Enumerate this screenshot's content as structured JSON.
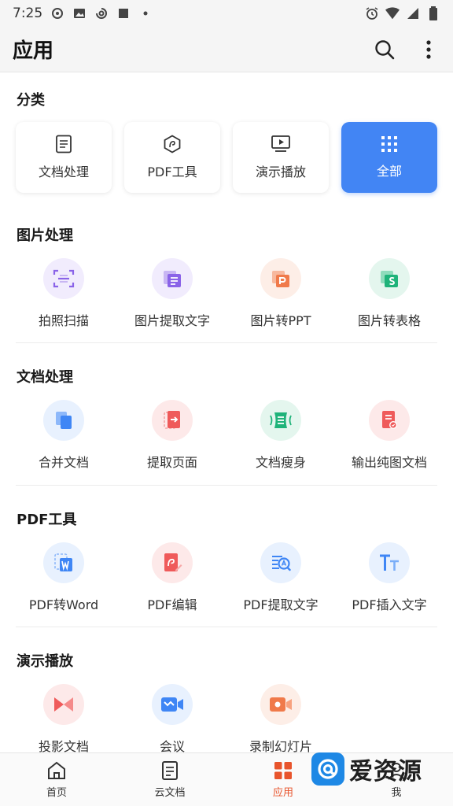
{
  "status_bar": {
    "time": "7:25"
  },
  "app_bar": {
    "title": "应用"
  },
  "sections": {
    "categories": "分类",
    "image": "图片处理",
    "doc": "文档处理",
    "pdf": "PDF工具",
    "present": "演示播放"
  },
  "categories": [
    {
      "label": "文档处理",
      "icon": "document-icon"
    },
    {
      "label": "PDF工具",
      "icon": "pdf-icon"
    },
    {
      "label": "演示播放",
      "icon": "presentation-icon"
    },
    {
      "label": "全部",
      "icon": "grid-icon",
      "active": true
    }
  ],
  "image_tools": [
    {
      "label": "拍照扫描",
      "icon": "scan-icon",
      "color": "#8a63e8",
      "bg": "#f1ecfd"
    },
    {
      "label": "图片提取文字",
      "icon": "image-text-icon",
      "color": "#8a63e8",
      "bg": "#f1ecfd"
    },
    {
      "label": "图片转PPT",
      "icon": "image-ppt-icon",
      "color": "#f07a4a",
      "bg": "#fdeee7"
    },
    {
      "label": "图片转表格",
      "icon": "image-sheet-icon",
      "color": "#1fb37a",
      "bg": "#e4f6ee"
    }
  ],
  "doc_tools": [
    {
      "label": "合并文档",
      "icon": "merge-icon",
      "color": "#3f86f5",
      "bg": "#e8f1fe"
    },
    {
      "label": "提取页面",
      "icon": "extract-page-icon",
      "color": "#ef5a5a",
      "bg": "#fde9e9"
    },
    {
      "label": "文档瘦身",
      "icon": "slim-icon",
      "color": "#1fb37a",
      "bg": "#e4f6ee"
    },
    {
      "label": "输出纯图文档",
      "icon": "image-doc-icon",
      "color": "#ef5a5a",
      "bg": "#fde9e9"
    }
  ],
  "pdf_tools": [
    {
      "label": "PDF转Word",
      "icon": "pdf-word-icon",
      "color": "#3f86f5",
      "bg": "#e8f1fe"
    },
    {
      "label": "PDF编辑",
      "icon": "pdf-edit-icon",
      "color": "#ef5a5a",
      "bg": "#fde9e9"
    },
    {
      "label": "PDF提取文字",
      "icon": "pdf-text-icon",
      "color": "#3f86f5",
      "bg": "#e8f1fe"
    },
    {
      "label": "PDF插入文字",
      "icon": "insert-text-icon",
      "color": "#3f86f5",
      "bg": "#e8f1fe"
    }
  ],
  "present_tools": [
    {
      "label": "投影文档",
      "icon": "projector-icon",
      "color": "#ef5a5a",
      "bg": "#fde9e9"
    },
    {
      "label": "会议",
      "icon": "meeting-icon",
      "color": "#3f86f5",
      "bg": "#e8f1fe"
    },
    {
      "label": "录制幻灯片",
      "icon": "record-icon",
      "color": "#f07a4a",
      "bg": "#fdeee7"
    }
  ],
  "bottom_nav": [
    {
      "label": "首页",
      "icon": "home-icon"
    },
    {
      "label": "云文档",
      "icon": "cloud-doc-icon"
    },
    {
      "label": "应用",
      "icon": "apps-icon",
      "active": true
    },
    {
      "label": "我",
      "icon": "profile-icon"
    }
  ],
  "watermark": {
    "text": "爱资源"
  },
  "colors": {
    "accent": "#4285f4",
    "nav_active": "#e8542c"
  }
}
